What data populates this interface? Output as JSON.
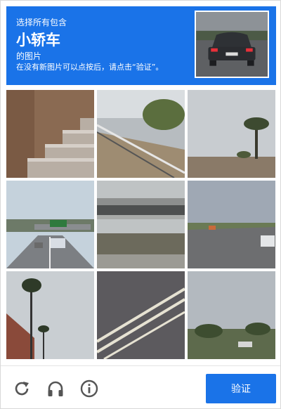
{
  "header": {
    "line1": "选择所有包含",
    "target": "小轿车",
    "line3": "的图片",
    "line4": "在没有新图片可以点按后，请点击“验证”。"
  },
  "sample_image": "car-rear-view",
  "tiles": [
    "stone-stairs",
    "highway-guardrail",
    "palm-tree-sky",
    "road-with-overpass-sign",
    "highway-overpass",
    "road-with-cars",
    "palm-trees-building",
    "road-lane-markings",
    "trees-field-sky"
  ],
  "footer": {
    "reload_icon": "reload-icon",
    "audio_icon": "headphones-icon",
    "info_icon": "info-icon",
    "verify_label": "验证"
  },
  "colors": {
    "accent": "#1a73e8",
    "icon": "#555555"
  }
}
